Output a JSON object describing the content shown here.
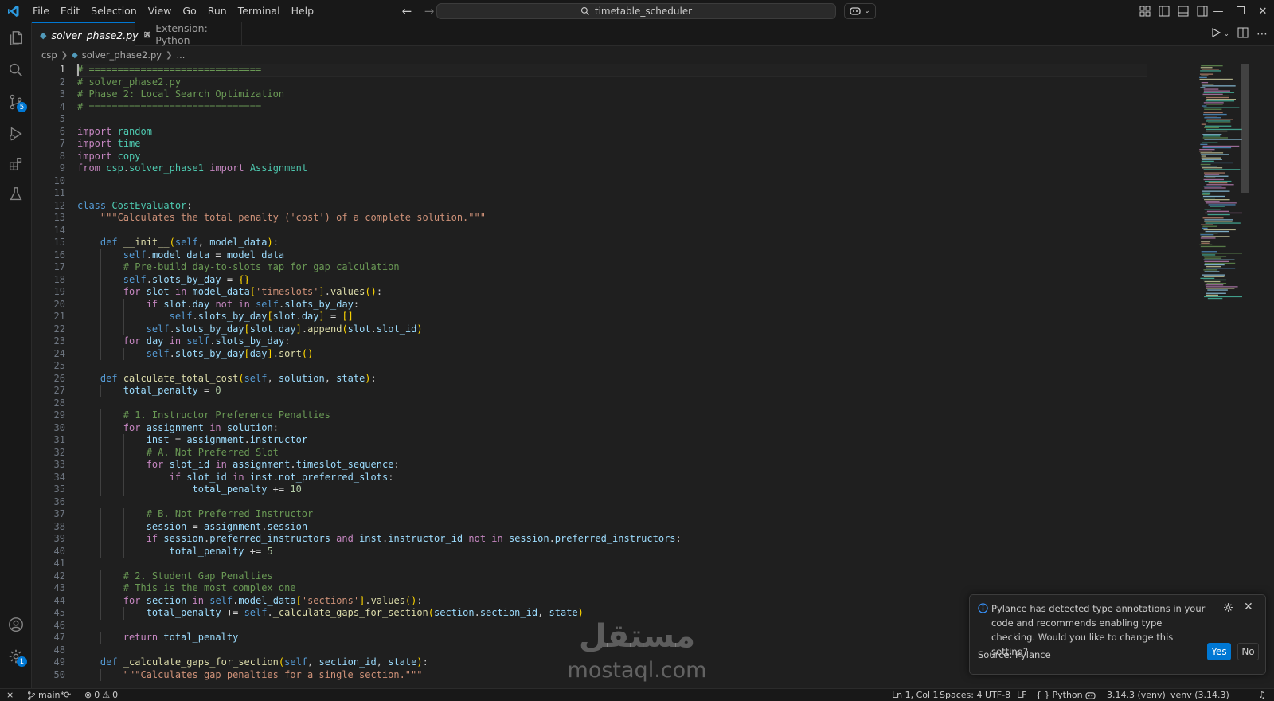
{
  "titlebar": {
    "menus": [
      "File",
      "Edit",
      "Selection",
      "View",
      "Go",
      "Run",
      "Terminal",
      "Help"
    ],
    "search_text": "timetable_scheduler"
  },
  "activitybar": {
    "source_control_badge": "5",
    "settings_badge": "1"
  },
  "tabs": [
    {
      "label": "solver_phase2.py",
      "active": true
    },
    {
      "label": "Extension: Python",
      "active": false
    }
  ],
  "breadcrumb": {
    "folder": "csp",
    "file": "solver_phase2.py",
    "more": "..."
  },
  "editor": {
    "lines": [
      "# ==============================",
      "# solver_phase2.py",
      "# Phase 2: Local Search Optimization",
      "# ==============================",
      "",
      "import random",
      "import time",
      "import copy",
      "from csp.solver_phase1 import Assignment",
      "",
      "",
      "class CostEvaluator:",
      "    \"\"\"Calculates the total penalty ('cost') of a complete solution.\"\"\"",
      "",
      "    def __init__(self, model_data):",
      "        self.model_data = model_data",
      "        # Pre-build day-to-slots map for gap calculation",
      "        self.slots_by_day = {}",
      "        for slot in model_data['timeslots'].values():",
      "            if slot.day not in self.slots_by_day:",
      "                self.slots_by_day[slot.day] = []",
      "            self.slots_by_day[slot.day].append(slot.slot_id)",
      "        for day in self.slots_by_day:",
      "            self.slots_by_day[day].sort()",
      "",
      "    def calculate_total_cost(self, solution, state):",
      "        total_penalty = 0",
      "",
      "        # 1. Instructor Preference Penalties",
      "        for assignment in solution:",
      "            inst = assignment.instructor",
      "            # A. Not Preferred Slot",
      "            for slot_id in assignment.timeslot_sequence:",
      "                if slot_id in inst.not_preferred_slots:",
      "                    total_penalty += 10",
      "",
      "            # B. Not Preferred Instructor",
      "            session = assignment.session",
      "            if session.preferred_instructors and inst.instructor_id not in session.preferred_instructors:",
      "                total_penalty += 5",
      "",
      "        # 2. Student Gap Penalties",
      "        # This is the most complex one",
      "        for section in self.model_data['sections'].values():",
      "            total_penalty += self._calculate_gaps_for_section(section.section_id, state)",
      "",
      "        return total_penalty",
      "",
      "    def _calculate_gaps_for_section(self, section_id, state):",
      "        \"\"\"Calculates gap penalties for a single section.\"\"\""
    ]
  },
  "notification": {
    "message": "Pylance has detected type annotations in your code and recommends enabling type checking. Would you like to change this setting?",
    "source": "Source: Pylance",
    "yes_label": "Yes",
    "no_label": "No"
  },
  "watermark": {
    "arabic": "مستقل",
    "latin": "mostaql.com"
  },
  "statusbar": {
    "branch": "main*",
    "errors": "0",
    "warnings": "0",
    "position": "Ln 1, Col 1",
    "spaces": "Spaces: 4",
    "encoding": "UTF-8",
    "eol": "LF",
    "language": "Python",
    "python_version": "3.14.3 (venv)",
    "interpreter": "venv (3.14.3)"
  },
  "colors": {
    "accent": "#0078d4",
    "comment": "#6a9955",
    "keyword": "#c586c0",
    "string": "#ce9178"
  },
  "icons": [
    "vscode-logo-icon",
    "explorer-icon",
    "search-icon",
    "source-control-icon",
    "run-debug-icon",
    "extensions-icon",
    "testing-icon",
    "account-icon",
    "settings-gear-icon",
    "python-file-icon",
    "run-icon",
    "split-editor-icon",
    "more-icon",
    "copilot-icon",
    "info-icon",
    "bell-icon"
  ]
}
